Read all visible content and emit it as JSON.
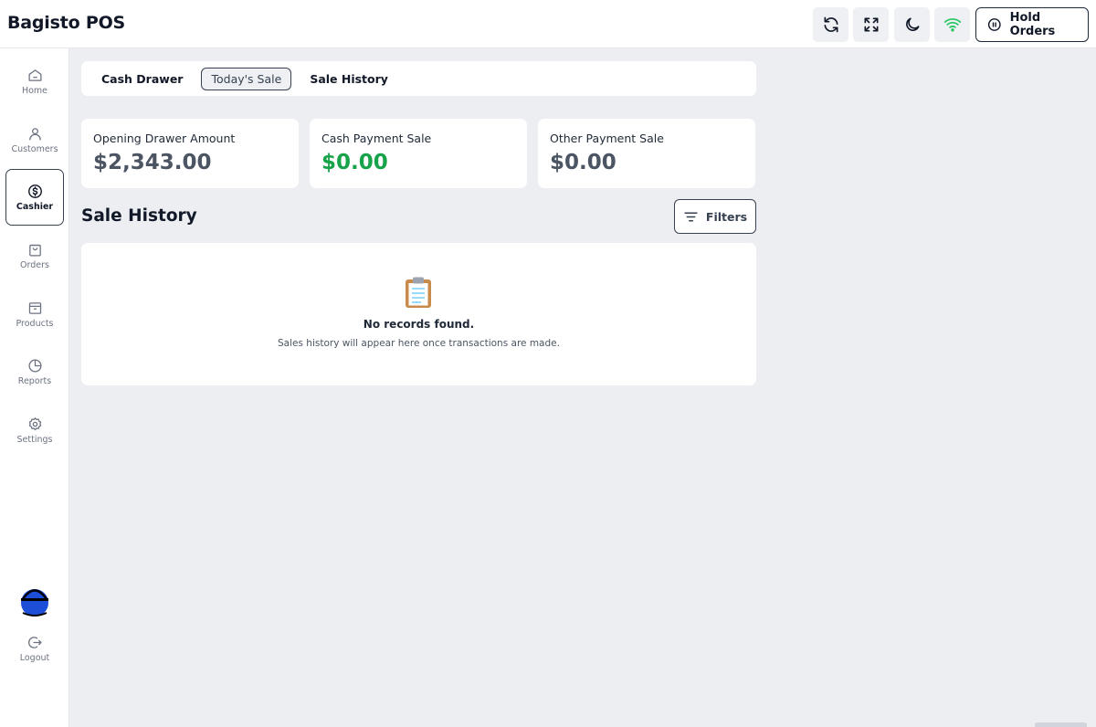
{
  "header": {
    "brand": "Bagisto POS",
    "hold_orders_label": "Hold Orders",
    "icons": [
      "refresh-icon",
      "fullscreen-icon",
      "moon-icon",
      "wifi-icon"
    ],
    "wifi_color": "#22c55e"
  },
  "sidebar": {
    "items": [
      {
        "label": "Home",
        "icon": "home-icon"
      },
      {
        "label": "Customers",
        "icon": "user-icon"
      },
      {
        "label": "Cashier",
        "icon": "dollar-circle-icon",
        "active": true
      },
      {
        "label": "Orders",
        "icon": "bag-icon"
      },
      {
        "label": "Products",
        "icon": "box-icon"
      },
      {
        "label": "Reports",
        "icon": "pie-chart-icon"
      },
      {
        "label": "Settings",
        "icon": "gear-icon"
      }
    ],
    "logout_label": "Logout",
    "avatar_color": "#1d4ed8"
  },
  "tabs": [
    {
      "label": "Cash Drawer"
    },
    {
      "label": "Today's Sale",
      "active": true
    },
    {
      "label": "Sale History"
    }
  ],
  "cards": [
    {
      "title": "Opening Drawer Amount",
      "value": "$2,343.00"
    },
    {
      "title": "Cash Payment Sale",
      "value": "$0.00",
      "color": "#16a34a"
    },
    {
      "title": "Other Payment Sale",
      "value": "$0.00"
    }
  ],
  "section": {
    "title": "Sale History",
    "filters_label": "Filters"
  },
  "empty_state": {
    "icon": "clipboard-icon",
    "title": "No records found.",
    "subtitle": "Sales history will appear here once transactions are made."
  }
}
